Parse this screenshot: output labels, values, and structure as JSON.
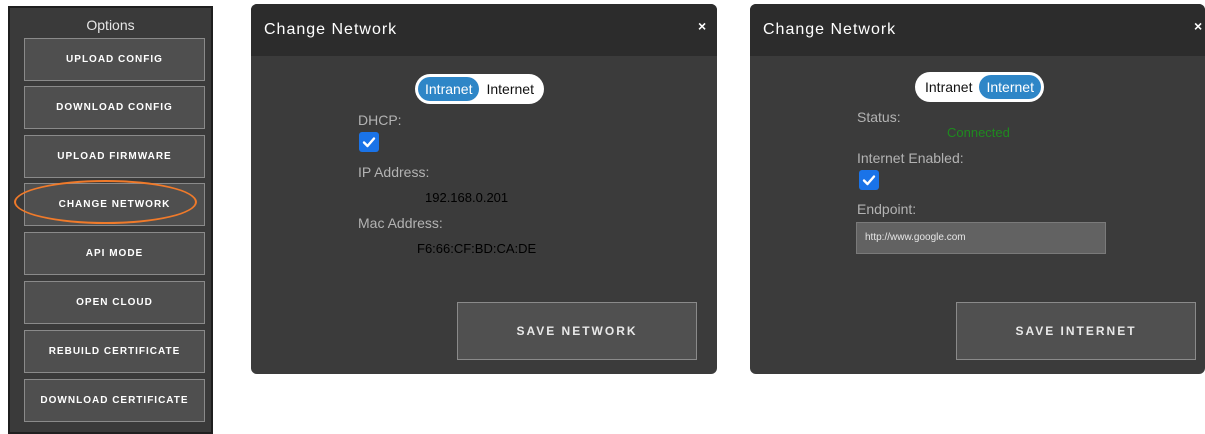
{
  "options": {
    "title": "Options",
    "buttons": [
      "UPLOAD CONFIG",
      "DOWNLOAD CONFIG",
      "UPLOAD FIRMWARE",
      "CHANGE NETWORK",
      "API MODE",
      "OPEN CLOUD",
      "REBUILD CERTIFICATE",
      "DOWNLOAD CERTIFICATE"
    ],
    "highlighted": "CHANGE NETWORK",
    "highlight_color": "#f07a2a"
  },
  "dialog_intranet": {
    "title": "Change Network",
    "close": "×",
    "toggle": {
      "left": "Intranet",
      "right": "Internet",
      "active": "Intranet"
    },
    "dhcp_label": "DHCP:",
    "dhcp_checked": true,
    "ip_label": "IP Address:",
    "ip_value": "192.168.0.201",
    "mac_label": "Mac Address:",
    "mac_value": "F6:66:CF:BD:CA:DE",
    "save_label": "SAVE NETWORK"
  },
  "dialog_internet": {
    "title": "Change Network",
    "close": "×",
    "toggle": {
      "left": "Intranet",
      "right": "Internet",
      "active": "Internet"
    },
    "status_label": "Status:",
    "status_value": "Connected",
    "status_color": "#1f8a1f",
    "enabled_label": "Internet Enabled:",
    "enabled_checked": true,
    "endpoint_label": "Endpoint:",
    "endpoint_value": "http://www.google.com",
    "save_label": "SAVE INTERNET"
  },
  "colors": {
    "toggle_active": "#2e86c7",
    "checkbox": "#1a73e8"
  }
}
